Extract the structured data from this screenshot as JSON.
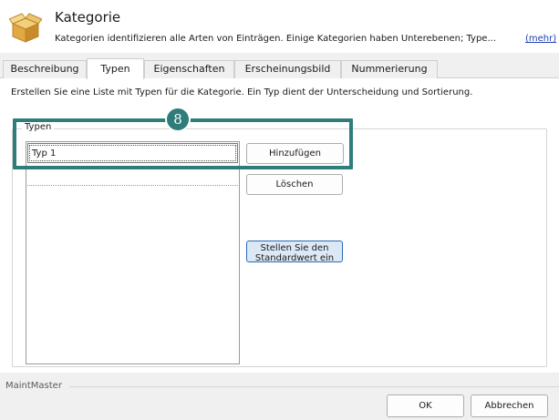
{
  "header": {
    "title": "Kategorie",
    "description": "Kategorien identifizieren alle Arten von Einträgen. Einige Kategorien haben Unterebenen; Type...",
    "more_link": "(mehr)",
    "icon": "box-icon"
  },
  "tabs": [
    {
      "label": "Beschreibung",
      "active": false
    },
    {
      "label": "Typen",
      "active": true
    },
    {
      "label": "Eigenschaften",
      "active": false
    },
    {
      "label": "Erscheinungsbild",
      "active": false
    },
    {
      "label": "Nummerierung",
      "active": false
    }
  ],
  "content": {
    "instruction": "Erstellen Sie eine Liste mit Typen für die Kategorie. Ein Typ dient der Unterscheidung und Sortierung.",
    "group_label": "Typen",
    "type_input_value": "Typ 1",
    "buttons": {
      "add": "Hinzufügen",
      "delete": "Löschen",
      "set_default_line1": "Stellen Sie den",
      "set_default_line2": "Standardwert ein"
    }
  },
  "annotation": {
    "step_number": "8",
    "color": "#2e7d7a"
  },
  "footer": {
    "brand": "MaintMaster",
    "ok": "OK",
    "cancel": "Abbrechen"
  }
}
